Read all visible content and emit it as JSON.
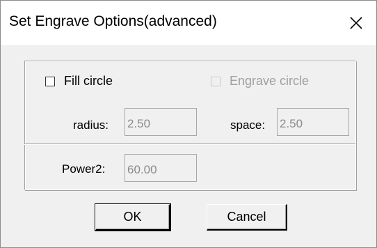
{
  "window": {
    "title": "Set Engrave Options(advanced)",
    "close_icon": "close-icon"
  },
  "options": {
    "fill_circle": {
      "label": "Fill circle",
      "checked": false,
      "enabled": true
    },
    "engrave_circle": {
      "label": "Engrave circle",
      "checked": false,
      "enabled": false
    }
  },
  "fields": {
    "radius": {
      "label": "radius:",
      "value": "2.50"
    },
    "space": {
      "label": "space:",
      "value": "2.50"
    },
    "power2": {
      "label": "Power2:",
      "value": "60.00"
    }
  },
  "buttons": {
    "ok": "OK",
    "cancel": "Cancel"
  },
  "colors": {
    "dialog_bg": "#f0f0f0",
    "disabled_text": "#a0a0a0"
  }
}
